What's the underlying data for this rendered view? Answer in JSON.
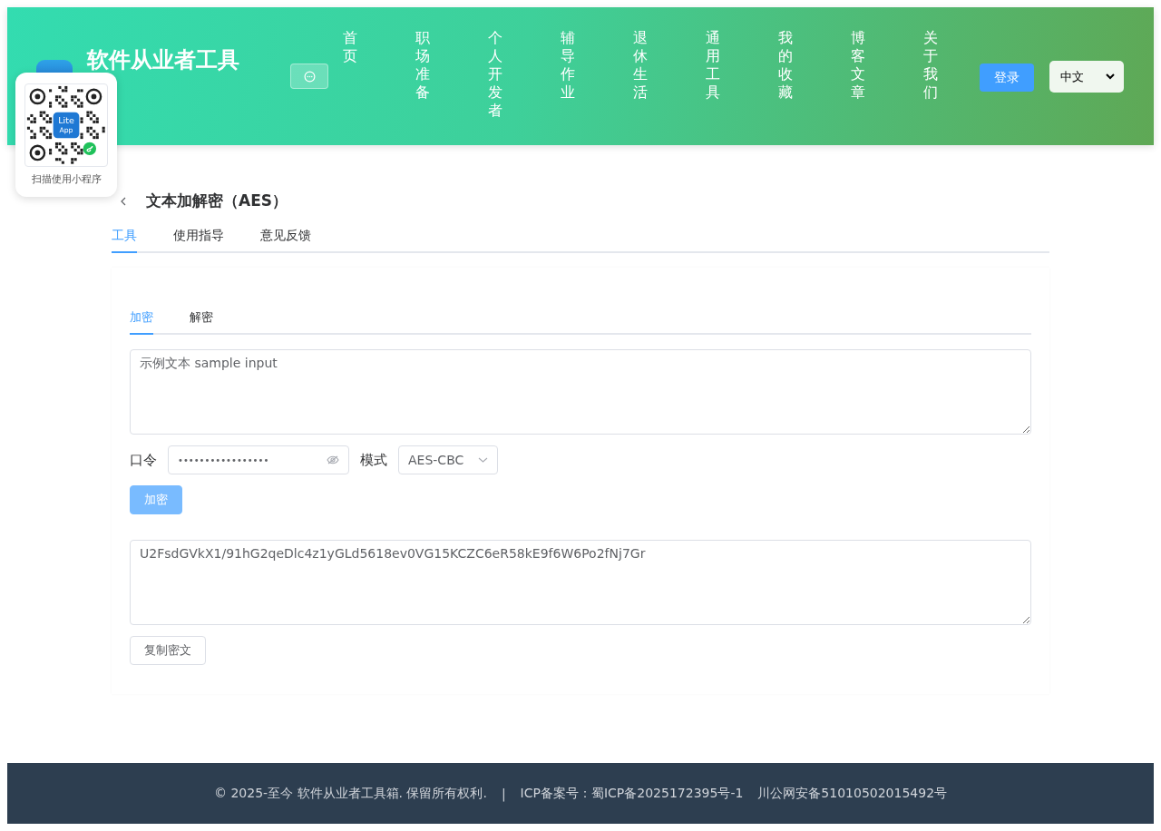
{
  "site": {
    "title": "软件从业者工具"
  },
  "nav": [
    {
      "label": "首页"
    },
    {
      "label": "职场准备"
    },
    {
      "label": "个人开发者"
    },
    {
      "label": "辅导作业"
    },
    {
      "label": "退休生活"
    },
    {
      "label": "通用工具"
    },
    {
      "label": "我的收藏"
    },
    {
      "label": "博客文章"
    },
    {
      "label": "关于我们"
    }
  ],
  "login_button": "登录",
  "language": {
    "value": "中文"
  },
  "qr_popup": {
    "logo_text": [
      "Lite",
      "App"
    ],
    "caption": "扫描使用小程序"
  },
  "page": {
    "title": "文本加解密（AES）",
    "tabs": [
      {
        "label": "工具",
        "selected": true
      },
      {
        "label": "使用指导",
        "selected": false
      },
      {
        "label": "意见反馈",
        "selected": false
      }
    ]
  },
  "tool": {
    "tabs": [
      {
        "label": "加密",
        "selected": true
      },
      {
        "label": "解密",
        "selected": false
      }
    ],
    "input": {
      "value": "示例文本 sample input"
    },
    "password": {
      "label": "口令",
      "value": "•••••••••••••••••"
    },
    "mode": {
      "label": "模式",
      "value": "AES-CBC"
    },
    "encrypt_button": {
      "label": "加密",
      "disabled": true
    },
    "output": {
      "value": "U2FsdGVkX1/91hG2qeDlc4z1yGLd5618ev0VG15KCZC6eR58kE9f6W6Po2fNj7Gr"
    },
    "copy_button": "复制密文"
  },
  "footer": {
    "copyright": "© 2025-至今 软件从业者工具箱. 保留所有权利.",
    "separator": "|",
    "icp": "ICP备案号：蜀ICP备2025172395号-1",
    "police": "川公网安备51010502015492号"
  }
}
